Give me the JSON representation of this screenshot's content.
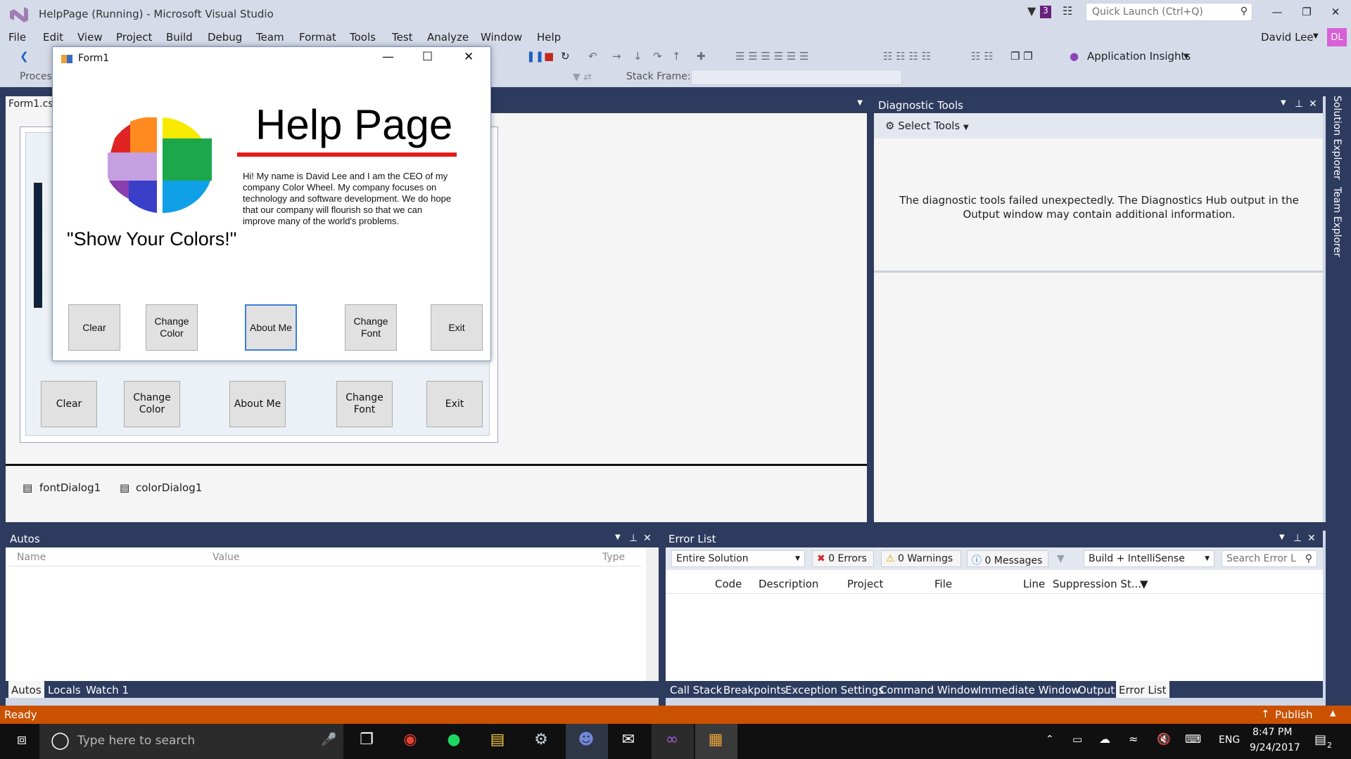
{
  "window": {
    "title": "HelpPage (Running) - Microsoft Visual Studio",
    "quick_launch_placeholder": "Quick Launch (Ctrl+Q)",
    "filter_badge": "3",
    "user_name": "David Lee",
    "avatar_initials": "DL"
  },
  "menu": [
    "File",
    "Edit",
    "View",
    "Project",
    "Build",
    "Debug",
    "Team",
    "Format",
    "Tools",
    "Test",
    "Analyze",
    "Window",
    "Help"
  ],
  "toolbar": {
    "application_insights": "Application Insights",
    "process_label": "Process:",
    "stack_frame_label": "Stack Frame:"
  },
  "editor": {
    "tab_label": "Form1.cs",
    "designer_buttons": [
      "Clear",
      "Change Color",
      "About Me",
      "Change Font",
      "Exit"
    ],
    "tray_items": [
      "fontDialog1",
      "colorDialog1"
    ]
  },
  "form1": {
    "title": "Form1",
    "heading": "Help Page",
    "bio": "Hi! My name is David Lee and I am the CEO of my company Color Wheel. My company focuses on technology and software development. We do hope that our company will flourish so that we can improve many of the world's problems.",
    "slogan": "\"Show Your Colors!\"",
    "buttons": [
      "Clear",
      "Change Color",
      "About Me",
      "Change Font",
      "Exit"
    ],
    "wheel_colors": [
      "#f7ea00",
      "#1ca84a",
      "#0fa0e8",
      "#3a3fc9",
      "#c4a0e0",
      "#e02424",
      "#ff8a1f"
    ]
  },
  "diagnostics": {
    "title": "Diagnostic Tools",
    "select_tools": "Select Tools",
    "message": "The diagnostic tools failed unexpectedly. The Diagnostics Hub output in the Output window may contain additional information."
  },
  "rail": [
    "Solution Explorer",
    "Team Explorer"
  ],
  "autos": {
    "title": "Autos",
    "columns": [
      "Name",
      "Value",
      "Type"
    ],
    "tabs": [
      "Autos",
      "Locals",
      "Watch 1"
    ]
  },
  "error_list": {
    "title": "Error List",
    "scope": "Entire Solution",
    "errors": "0 Errors",
    "warnings": "0 Warnings",
    "messages": "0 Messages",
    "build_filter": "Build + IntelliSense",
    "search_placeholder": "Search Error L",
    "columns": [
      "Code",
      "Description",
      "Project",
      "File",
      "Line",
      "Suppression St..."
    ],
    "tabs": [
      "Call Stack",
      "Breakpoints",
      "Exception Settings",
      "Command Window",
      "Immediate Window",
      "Output",
      "Error List"
    ]
  },
  "status": {
    "text": "Ready",
    "publish": "Publish"
  },
  "taskbar": {
    "search_placeholder": "Type here to search",
    "language": "ENG",
    "time": "8:47 PM",
    "date": "9/24/2017",
    "notification_count": "2"
  },
  "colors": {
    "accent_frame": "#2d3b5f",
    "status_bar": "#ca5100",
    "vs_purple": "#68217a"
  }
}
